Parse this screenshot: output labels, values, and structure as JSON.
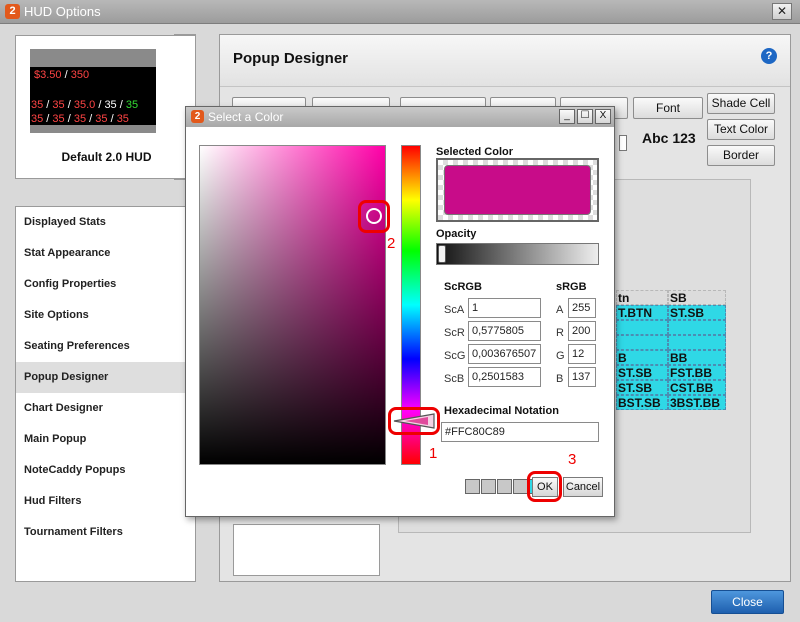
{
  "window": {
    "title": "HUD Options",
    "logo": "2",
    "close_glyph": "✕"
  },
  "hud_preview": {
    "label": "Default 2.0 HUD",
    "line1": [
      {
        "t": "$3.50",
        "c": "#ff4444"
      },
      {
        "t": " / ",
        "c": "#ffffff"
      },
      {
        "t": "350",
        "c": "#ff4444"
      }
    ],
    "line2": [
      {
        "t": "35",
        "c": "#ff4444"
      },
      {
        "t": " / ",
        "c": "#ffffff"
      },
      {
        "t": "35",
        "c": "#ff4444"
      },
      {
        "t": " / ",
        "c": "#ffffff"
      },
      {
        "t": "35.0",
        "c": "#ff4444"
      },
      {
        "t": " / ",
        "c": "#ffffff"
      },
      {
        "t": "35",
        "c": "#ffffff"
      },
      {
        "t": " / ",
        "c": "#ffffff"
      },
      {
        "t": "35",
        "c": "#33dd33"
      }
    ],
    "line3": [
      {
        "t": "35",
        "c": "#ff4444"
      },
      {
        "t": " / ",
        "c": "#ffffff"
      },
      {
        "t": "35",
        "c": "#ff4444"
      },
      {
        "t": " / ",
        "c": "#ffffff"
      },
      {
        "t": "35",
        "c": "#ff4444"
      },
      {
        "t": " / ",
        "c": "#ffffff"
      },
      {
        "t": "35",
        "c": "#ff4444"
      },
      {
        "t": " / ",
        "c": "#ffffff"
      },
      {
        "t": "35",
        "c": "#ff4444"
      }
    ]
  },
  "nav": {
    "items": [
      "Displayed Stats",
      "Stat Appearance",
      "Config Properties",
      "Site Options",
      "Seating Preferences",
      "Popup Designer",
      "Chart Designer",
      "Main Popup",
      "NoteCaddy Popups",
      "Hud Filters",
      "Tournament Filters"
    ],
    "active_index": 5
  },
  "panel": {
    "title": "Popup Designer",
    "help_glyph": "?",
    "font_button": "Font",
    "shade_cell_button": "Shade Cell",
    "text_color_button": "Text Color",
    "border_button": "Border",
    "sample_text": "Abc 123",
    "table": {
      "rows": [
        [
          "tn",
          "SB"
        ],
        [
          "T.BTN",
          "ST.SB"
        ],
        [
          "",
          ""
        ],
        [
          "",
          ""
        ],
        [
          "B",
          "BB"
        ],
        [
          "ST.SB",
          "FST.BB"
        ],
        [
          "ST.SB",
          "CST.BB"
        ],
        [
          "BST.SB",
          "3BST.BB"
        ]
      ]
    }
  },
  "close_button": "Close",
  "dialog": {
    "title": "Select a Color",
    "logo": "2",
    "controls": {
      "minimize": "_",
      "maximize": "☐",
      "close": "X"
    },
    "selected_color_label": "Selected Color",
    "selected_color": "#C80C89",
    "opacity_label": "Opacity",
    "scrgb_label": "ScRGB",
    "srgb_label": "sRGB",
    "scrgb": [
      {
        "label": "ScA",
        "value": "1"
      },
      {
        "label": "ScR",
        "value": "0,5775805"
      },
      {
        "label": "ScG",
        "value": "0,003676507"
      },
      {
        "label": "ScB",
        "value": "0,2501583"
      }
    ],
    "srgb": [
      {
        "label": "A",
        "value": "255"
      },
      {
        "label": "R",
        "value": "200"
      },
      {
        "label": "G",
        "value": "12"
      },
      {
        "label": "B",
        "value": "137"
      }
    ],
    "hex_label": "Hexadecimal Notation",
    "hex_value": "#FFC80C89",
    "ok_button": "OK",
    "cancel_button": "Cancel",
    "recent_swatches": [
      "#c8c8c8",
      "#c8c8c8",
      "#c8c8c8",
      "#c8c8c8",
      "#2fd8e6"
    ]
  },
  "annotations": {
    "one": "1",
    "two": "2",
    "three": "3"
  }
}
